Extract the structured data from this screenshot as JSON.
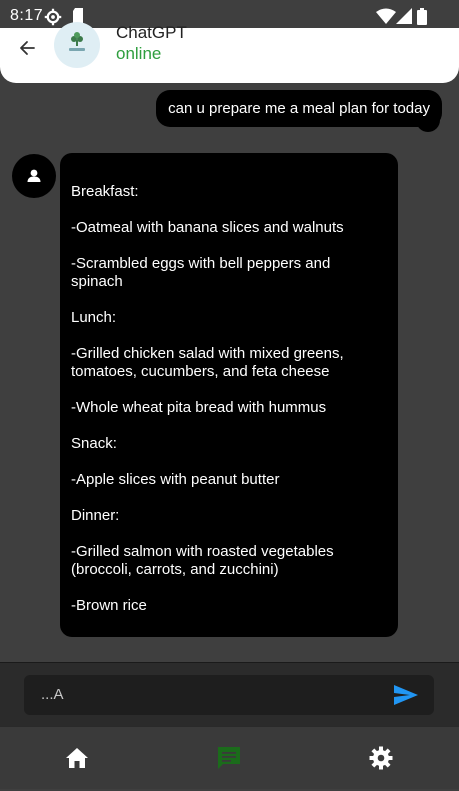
{
  "status_bar": {
    "time": "8:17",
    "icons": [
      "settings-gear-icon",
      "sim-card-icon",
      "wifi-icon",
      "signal-icon",
      "battery-icon"
    ]
  },
  "header": {
    "back_icon": "arrow-left-icon",
    "avatar_icon": "plant-logo-icon",
    "title": "ChatGPT",
    "status": "online",
    "status_color": "#2e9e3e"
  },
  "messages": [
    {
      "role": "user",
      "text": "can u prepare me a meal plan for today"
    },
    {
      "role": "assistant",
      "avatar_icon": "person-icon",
      "text": "Breakfast:\n\n-Oatmeal with banana slices and walnuts\n\n-Scrambled eggs with bell peppers and spinach\n\nLunch:\n\n-Grilled chicken salad with mixed greens, tomatoes, cucumbers, and feta cheese\n\n-Whole wheat pita bread with hummus\n\nSnack:\n\n-Apple slices with peanut butter\n\nDinner:\n\n-Grilled salmon with roasted vegetables (broccoli, carrots, and zucchini)\n\n-Brown rice"
    }
  ],
  "composer": {
    "value": "...A",
    "send_icon": "send-icon",
    "accent": "#2196f3"
  },
  "bottom_nav": {
    "items": [
      {
        "icon": "home-icon",
        "active": false
      },
      {
        "icon": "chat-icon",
        "active": true,
        "color": "#1b6b1b"
      },
      {
        "icon": "settings-icon",
        "active": false
      }
    ]
  }
}
